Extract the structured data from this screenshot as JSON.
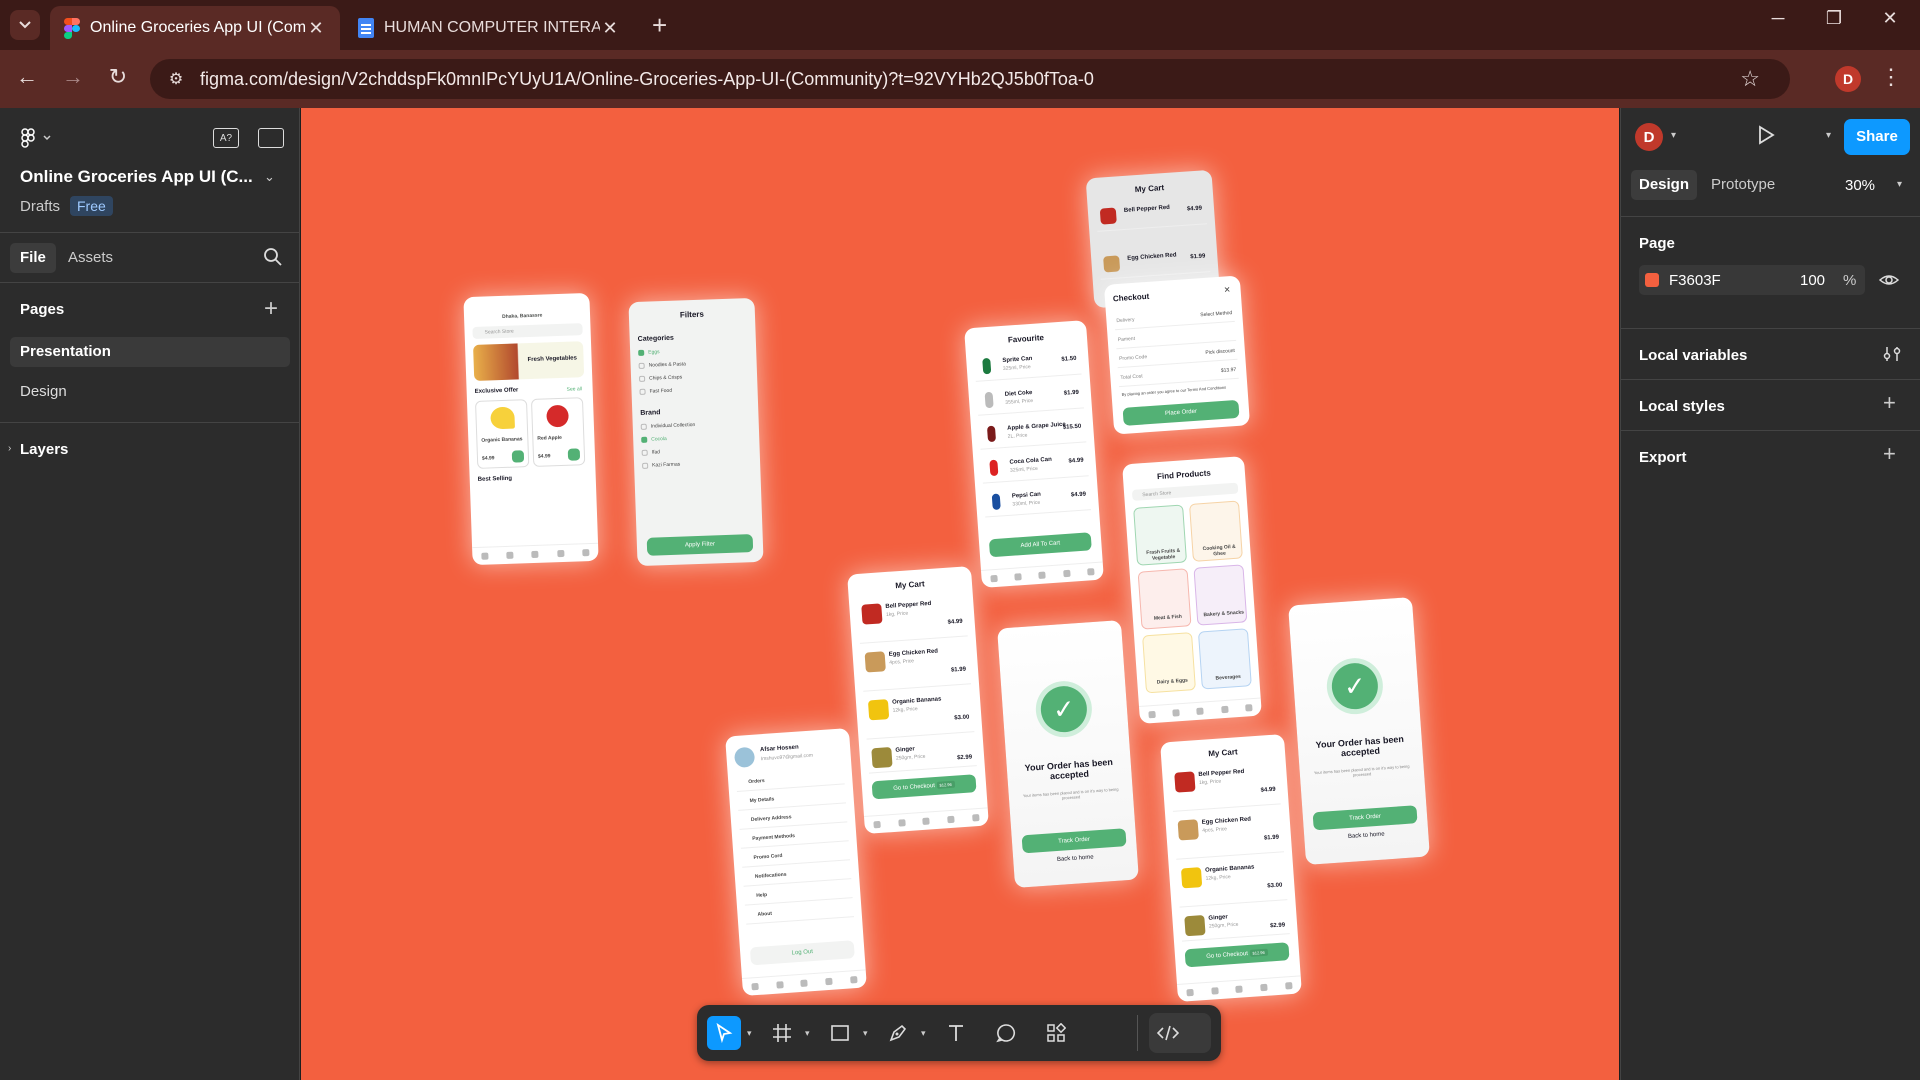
{
  "browser": {
    "tabs": [
      {
        "title": "Online Groceries App UI (Comm",
        "active": true,
        "icon": "figma-icon"
      },
      {
        "title": "HUMAN COMPUTER INTERACTI",
        "active": false,
        "icon": "docs-icon"
      }
    ],
    "url": "figma.com/design/V2chddspFk0mnIPcYUyU1A/Online-Groceries-App-UI-(Community)?t=92VYHb2QJ5b0fToa-0",
    "profile_initial": "D"
  },
  "left_panel": {
    "file_title": "Online Groceries App UI (C...",
    "location": "Drafts",
    "plan_badge": "Free",
    "tabs": [
      "File",
      "Assets"
    ],
    "pages_label": "Pages",
    "pages": [
      "Presentation",
      "Design"
    ],
    "layers_label": "Layers"
  },
  "right_panel": {
    "avatar_initial": "D",
    "share_label": "Share",
    "tabs": [
      "Design",
      "Prototype"
    ],
    "zoom": "30%",
    "page_label": "Page",
    "fill_hex": "F3603F",
    "fill_opacity": "100",
    "fill_percent": "%",
    "sections": [
      "Local variables",
      "Local styles",
      "Export"
    ]
  },
  "canvas": {
    "background": "#F3603F",
    "screens": {
      "home": {
        "location": "Dhaka, Banassre",
        "search": "Search Store",
        "banner": "Fresh Vegetables",
        "exclusive": "Exclusive Offer",
        "see_all": "See all",
        "item1": "Organic Bananas",
        "item1_price": "$4.99",
        "item2": "Red Apple",
        "item2_price": "$4.99",
        "best": "Best Selling"
      },
      "filters": {
        "title": "Filters",
        "categories": "Categories",
        "cat_items": [
          "Eggs",
          "Noodles & Pasta",
          "Chips & Crisps",
          "Fast Food"
        ],
        "brand": "Brand",
        "brand_items": [
          "Individual Collection",
          "Cocola",
          "Ifad",
          "Kazi Farmas"
        ],
        "apply": "Apply Filter"
      },
      "favourite": {
        "title": "Favourite",
        "items": [
          {
            "name": "Sprite Can",
            "sub": "325ml, Price",
            "price": "$1.50"
          },
          {
            "name": "Diet Coke",
            "sub": "355ml, Price",
            "price": "$1.99"
          },
          {
            "name": "Apple & Grape Juice",
            "sub": "2L, Price",
            "price": "$15.50"
          },
          {
            "name": "Coca Cola Can",
            "sub": "325ml, Price",
            "price": "$4.99"
          },
          {
            "name": "Pepsi Can",
            "sub": "330ml, Price",
            "price": "$4.99"
          }
        ],
        "button": "Add All To Cart"
      },
      "cart_top": {
        "title": "My Cart",
        "items": [
          {
            "name": "Bell Pepper Red",
            "price": "$4.99"
          },
          {
            "name": "Egg Chicken Red",
            "price": "$1.99"
          }
        ]
      },
      "checkout": {
        "title": "Checkout",
        "rows": [
          {
            "label": "Delivery",
            "value": "Select Method"
          },
          {
            "label": "Pament",
            "value": ""
          },
          {
            "label": "Promo Code",
            "value": "Pick discount"
          },
          {
            "label": "Total Cost",
            "value": "$13.97"
          }
        ],
        "terms": "By placing an order you agree to our Terms And Conditions",
        "button": "Place Order"
      },
      "find": {
        "title": "Find Products",
        "search": "Search Store",
        "cats": [
          "Frash Fruits & Vegetable",
          "Cooking Oil & Ghee",
          "Meat & Fish",
          "Bakery & Snacks",
          "Dairy & Eggs",
          "Beverages"
        ]
      },
      "cart_mid": {
        "title": "My Cart",
        "items": [
          {
            "name": "Bell Pepper Red",
            "sub": "1kg, Price",
            "price": "$4.99"
          },
          {
            "name": "Egg Chicken Red",
            "sub": "4pcs, Price",
            "price": "$1.99"
          },
          {
            "name": "Organic Bananas",
            "sub": "12kg, Price",
            "price": "$3.00"
          },
          {
            "name": "Ginger",
            "sub": "250gm, Price",
            "price": "$2.99"
          }
        ],
        "button": "Go to Checkout",
        "badge": "$12.96"
      },
      "accepted1": {
        "msg": "Your Order has been accepted",
        "sub": "Your items has been placcd and is on it's way to being processed",
        "button": "Track Order",
        "link": "Back to home"
      },
      "accepted2": {
        "msg": "Your Order has been accepted",
        "sub": "Your items has been placcd and is on it's way to being processed",
        "button": "Track Order",
        "link": "Back to home"
      },
      "account": {
        "name": "Afsar Hossen",
        "email": "Imshuvo97@gmail.com",
        "items": [
          "Orders",
          "My Details",
          "Delivery Address",
          "Payment Methods",
          "Promo Cord",
          "Notifecations",
          "Help",
          "About"
        ],
        "logout": "Log Out"
      },
      "cart_bottom": {
        "title": "My Cart",
        "items": [
          {
            "name": "Bell Pepper Red",
            "sub": "1kg, Price",
            "price": "$4.99"
          },
          {
            "name": "Egg Chicken Red",
            "sub": "4pcs, Price",
            "price": "$1.99"
          },
          {
            "name": "Organic Bananas",
            "sub": "12kg, Price",
            "price": "$3.00"
          },
          {
            "name": "Ginger",
            "sub": "250gm, Price",
            "price": "$2.99"
          }
        ],
        "button": "Go to Checkout",
        "badge": "$12.96"
      }
    }
  },
  "toolbar": {
    "tools": [
      "move-tool",
      "frame-tool",
      "shape-tool",
      "pen-tool",
      "text-tool",
      "comment-tool",
      "actions-tool",
      "dev-mode-toggle"
    ]
  },
  "help_label": "?"
}
